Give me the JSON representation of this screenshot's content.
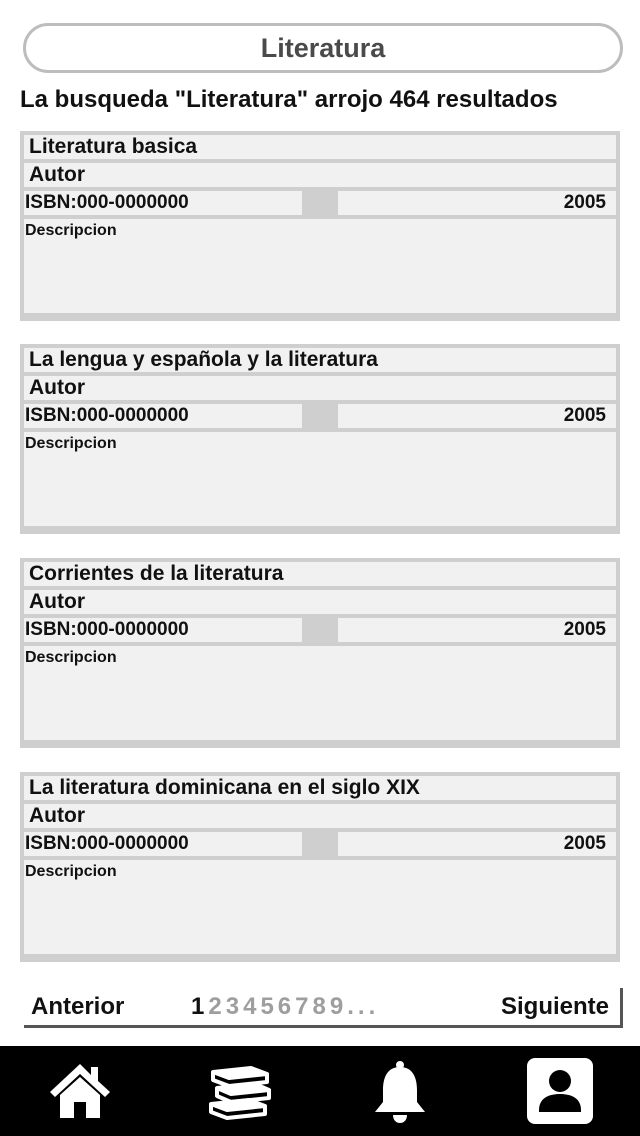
{
  "search": {
    "query": "Literatura"
  },
  "results_summary": "La busqueda \"Literatura\" arrojo 464 resultados",
  "results": [
    {
      "title": "Literatura basica",
      "author": "Autor",
      "isbn": "ISBN:000-0000000",
      "year": "2005",
      "description": "Descripcion"
    },
    {
      "title": "La lengua y española y la literatura",
      "author": "Autor",
      "isbn": "ISBN:000-0000000",
      "year": "2005",
      "description": "Descripcion"
    },
    {
      "title": "Corrientes de la literatura",
      "author": "Autor",
      "isbn": "ISBN:000-0000000",
      "year": "2005",
      "description": "Descripcion"
    },
    {
      "title": "La literatura dominicana en el siglo XIX",
      "author": "Autor",
      "isbn": "ISBN:000-0000000",
      "year": "2005",
      "description": "Descripcion"
    }
  ],
  "pagination": {
    "prev_label": "Anterior",
    "next_label": "Siguiente",
    "pages": [
      "1",
      "2",
      "3",
      "4",
      "5",
      "6",
      "7",
      "8",
      "9"
    ],
    "current_page": "1",
    "ellipsis": "..."
  },
  "bottom_nav": {
    "items": [
      {
        "icon": "home-icon"
      },
      {
        "icon": "books-icon"
      },
      {
        "icon": "bell-icon"
      },
      {
        "icon": "profile-icon",
        "active": true
      }
    ]
  },
  "colors": {
    "card_border": "#cfcfcf",
    "card_fill": "#f1f1f1",
    "nav_bg": "#000000",
    "inactive_page": "#9e9e9e"
  }
}
